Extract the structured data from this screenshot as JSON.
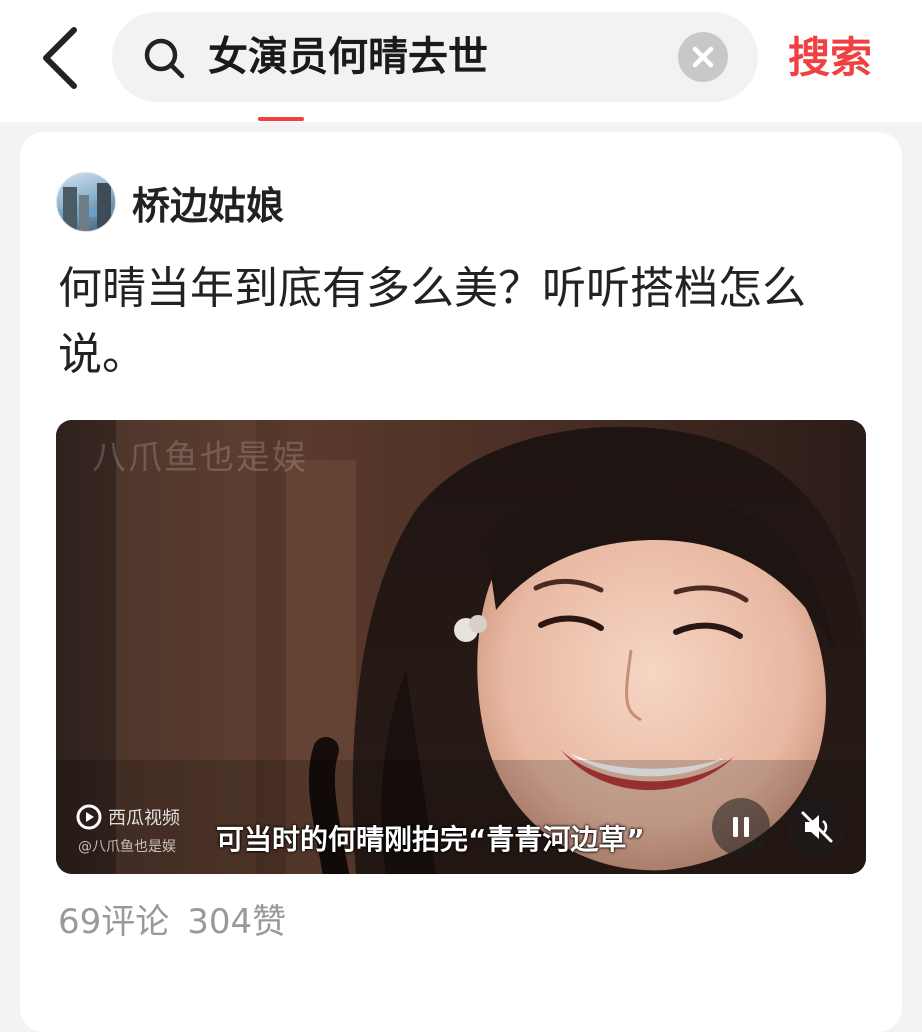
{
  "header": {
    "search_query": "女演员何晴去世",
    "search_button_label": "搜索"
  },
  "post": {
    "author_name": "桥边姑娘",
    "title": "何晴当年到底有多么美？听听搭档怎么说。",
    "video": {
      "watermark": "八爪鱼也是娱",
      "brand_name": "西瓜视频",
      "brand_handle": "@八爪鱼也是娱",
      "subtitle": "可当时的何晴刚拍完“青青河边草”"
    },
    "stats": {
      "comments": "69评论",
      "likes": "304赞"
    }
  },
  "colors": {
    "accent": "#f04142",
    "muted_text": "#999999",
    "search_bg": "#f2f2f2"
  },
  "icons": {
    "back": "chevron-left-icon",
    "search": "search-icon",
    "clear": "close-circle-icon",
    "pause": "pause-icon",
    "mute": "mute-icon",
    "brand": "xigua-logo-icon"
  }
}
